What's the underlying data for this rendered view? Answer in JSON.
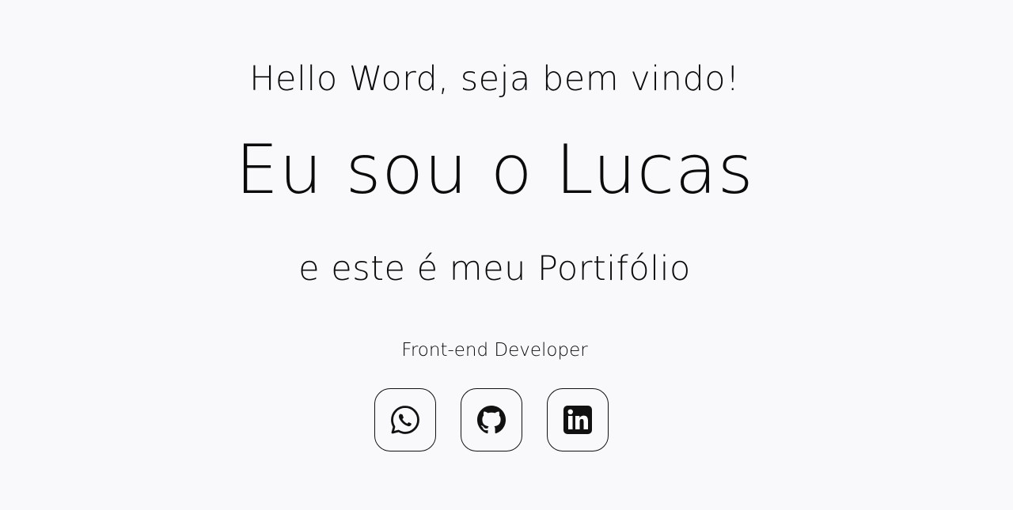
{
  "hero": {
    "greeting": "Hello Word, seja bem vindo!",
    "headline": "Eu sou o Lucas",
    "subline": "e este é meu Portifólio",
    "role": "Front-end Developer"
  },
  "social_links": [
    {
      "icon": "whatsapp-icon"
    },
    {
      "icon": "github-icon"
    },
    {
      "icon": "linkedin-icon"
    }
  ],
  "colors": {
    "background": "#f9f9fc",
    "text": "#0b0b0b",
    "border": "#111111"
  }
}
